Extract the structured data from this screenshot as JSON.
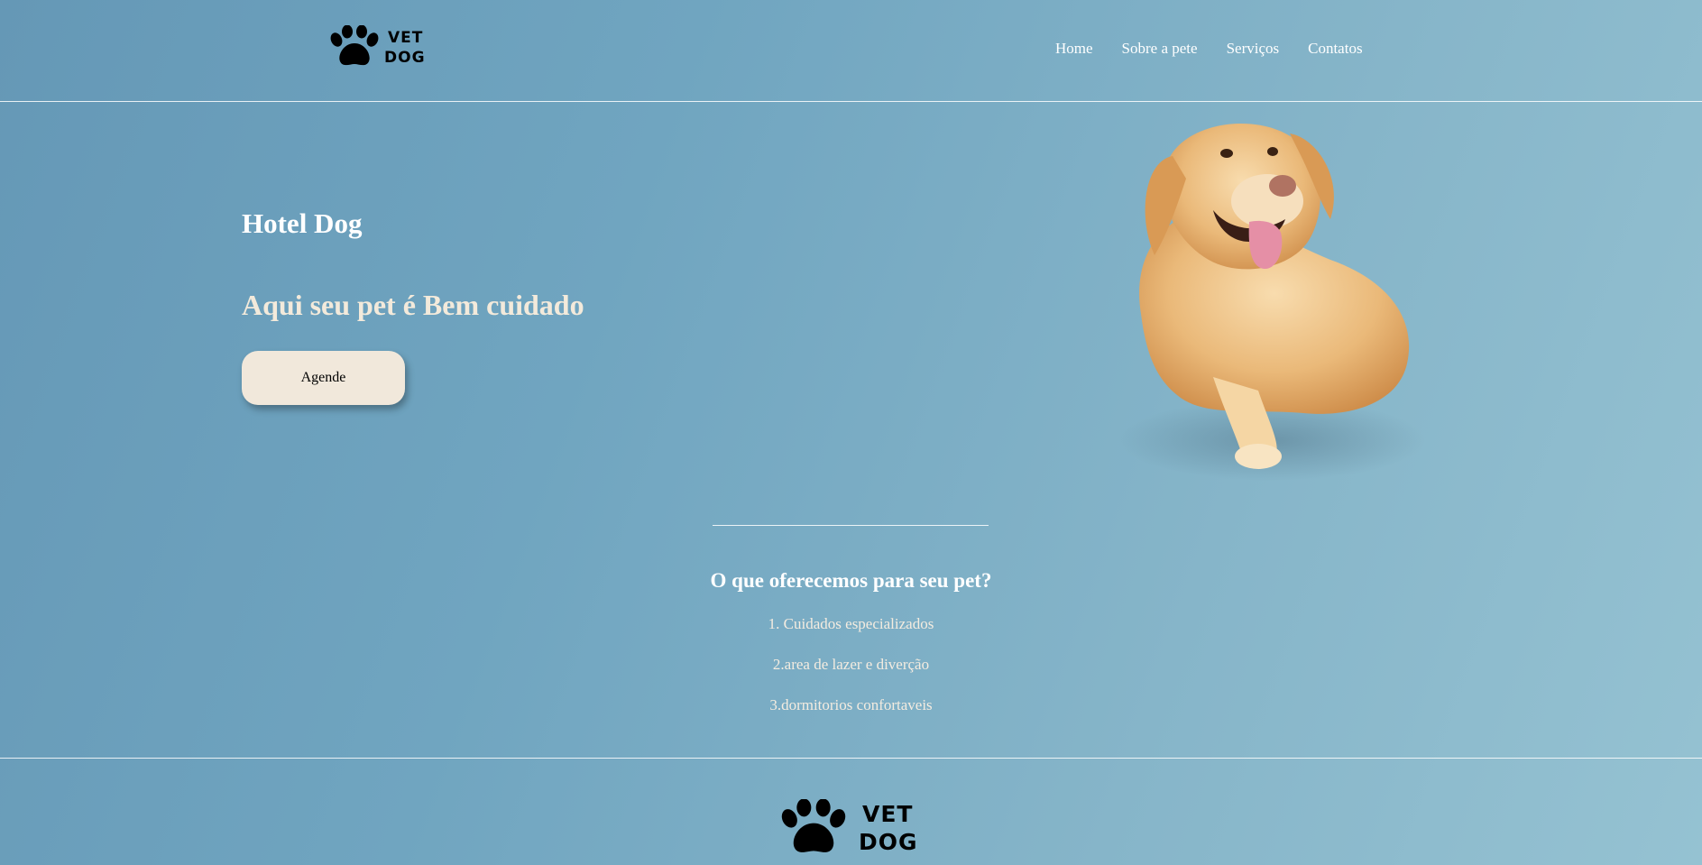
{
  "brand": {
    "logo_line1": "VET",
    "logo_line2": "DOG"
  },
  "nav": {
    "items": [
      "Home",
      "Sobre a pete",
      "Serviços",
      "Contatos"
    ]
  },
  "hero": {
    "title": "Hotel Dog",
    "subtitle": "Aqui seu pet é Bem cuidado",
    "cta_label": "Agende"
  },
  "services": {
    "title": "O que oferecemos para seu pet?",
    "items": [
      "1. Cuidados especializados",
      "2.area de lazer e diverção",
      "3.dormitorios confortaveis"
    ]
  },
  "footer": {
    "logo_line1": "VET",
    "logo_line2": "DOG"
  },
  "colors": {
    "background_start": "#6598b6",
    "background_end": "#95c2d2",
    "button_bg": "#f1e8db",
    "accent_text": "#f3eadb"
  }
}
